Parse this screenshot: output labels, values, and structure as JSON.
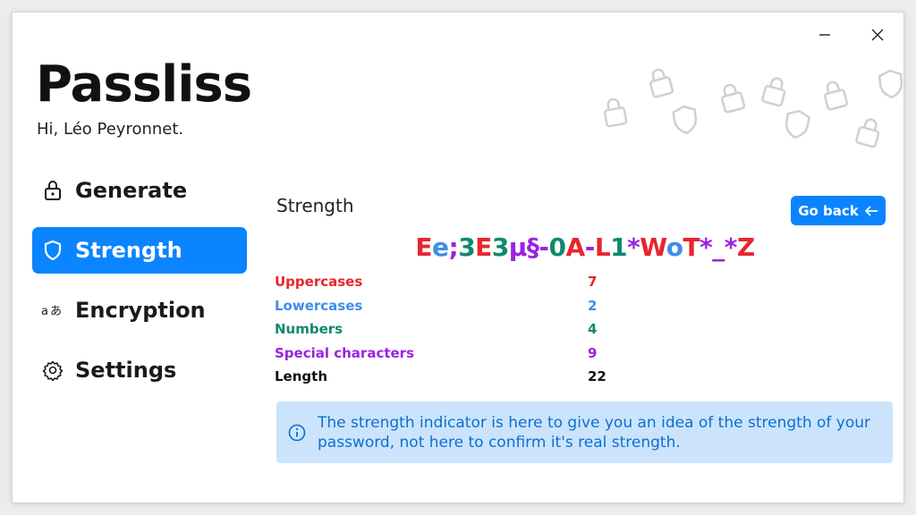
{
  "app": {
    "title": "Passliss",
    "greeting": "Hi, Léo Peyronnet."
  },
  "window_controls": {
    "minimize_icon": "minimize-icon",
    "close_icon": "close-icon"
  },
  "sidebar": {
    "items": [
      {
        "label": "Generate",
        "icon": "lock-icon",
        "active": false
      },
      {
        "label": "Strength",
        "icon": "shield-icon",
        "active": true
      },
      {
        "label": "Encryption",
        "icon": "translate-icon",
        "active": false
      },
      {
        "label": "Settings",
        "icon": "gear-icon",
        "active": false
      }
    ]
  },
  "main": {
    "section_title": "Strength",
    "go_back_label": "Go back",
    "password": [
      {
        "text": "E",
        "color": "#e8262b"
      },
      {
        "text": "e",
        "color": "#3f8ee8"
      },
      {
        "text": ";",
        "color": "#9b22e0"
      },
      {
        "text": "3",
        "color": "#0e8a6c"
      },
      {
        "text": "E",
        "color": "#e8262b"
      },
      {
        "text": "3",
        "color": "#0e8a6c"
      },
      {
        "text": "µ§-",
        "color": "#9b22e0"
      },
      {
        "text": "0",
        "color": "#0e8a6c"
      },
      {
        "text": "A",
        "color": "#e8262b"
      },
      {
        "text": "-",
        "color": "#9b22e0"
      },
      {
        "text": "L",
        "color": "#e8262b"
      },
      {
        "text": "1",
        "color": "#0e8a6c"
      },
      {
        "text": "*",
        "color": "#9b22e0"
      },
      {
        "text": "W",
        "color": "#e8262b"
      },
      {
        "text": "o",
        "color": "#3f8ee8"
      },
      {
        "text": "T",
        "color": "#e8262b"
      },
      {
        "text": "*_*",
        "color": "#9b22e0"
      },
      {
        "text": "Z",
        "color": "#e8262b"
      }
    ],
    "stats": [
      {
        "label": "Uppercases",
        "value": "7",
        "color": "#e8262b"
      },
      {
        "label": "Lowercases",
        "value": "2",
        "color": "#3f8ee8"
      },
      {
        "label": "Numbers",
        "value": "4",
        "color": "#0e8a6c"
      },
      {
        "label": "Special characters",
        "value": "9",
        "color": "#9b22e0"
      },
      {
        "label": "Length",
        "value": "22",
        "color": "#111111"
      }
    ],
    "info_text": "The strength indicator is here to give you an idea of the strength of your password, not here to confirm it's real strength.",
    "info_icon": "info-icon"
  },
  "colors": {
    "accent": "#0a84ff",
    "info_bg": "#cce4fb",
    "info_text": "#0a6fd4"
  }
}
